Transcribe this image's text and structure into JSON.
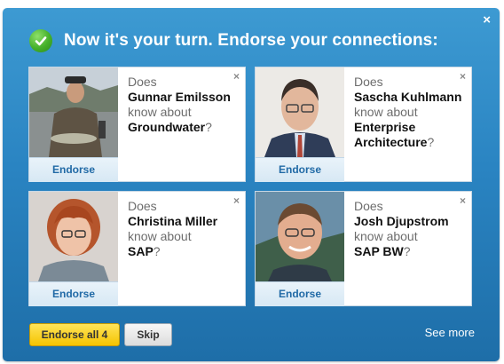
{
  "dialog": {
    "title": "Now it's your turn. Endorse your connections:",
    "close": "×"
  },
  "cards": [
    {
      "does": "Does",
      "name": "Gunnar Emilsson",
      "know": "know about",
      "skill": "Groundwater",
      "q": "?",
      "endorse": "Endorse",
      "close": "×"
    },
    {
      "does": "Does",
      "name": "Sascha Kuhlmann",
      "know": "know about",
      "skill": "Enterprise Architecture",
      "q": "?",
      "endorse": "Endorse",
      "close": "×"
    },
    {
      "does": "Does",
      "name": "Christina Miller",
      "know": "know about",
      "skill": "SAP",
      "q": "?",
      "endorse": "Endorse",
      "close": "×"
    },
    {
      "does": "Does",
      "name": "Josh Djupstrom",
      "know": "know about",
      "skill": "SAP BW",
      "q": "?",
      "endorse": "Endorse",
      "close": "×"
    }
  ],
  "footer": {
    "endorse_all": "Endorse all 4",
    "skip": "Skip",
    "see_more": "See more"
  },
  "colors": {
    "panel": "#2a84c2",
    "endorse_link": "#216aa6",
    "primary_button": "#f5c400",
    "check": "#44b02a"
  },
  "icons": [
    "check-icon",
    "close-icon"
  ]
}
